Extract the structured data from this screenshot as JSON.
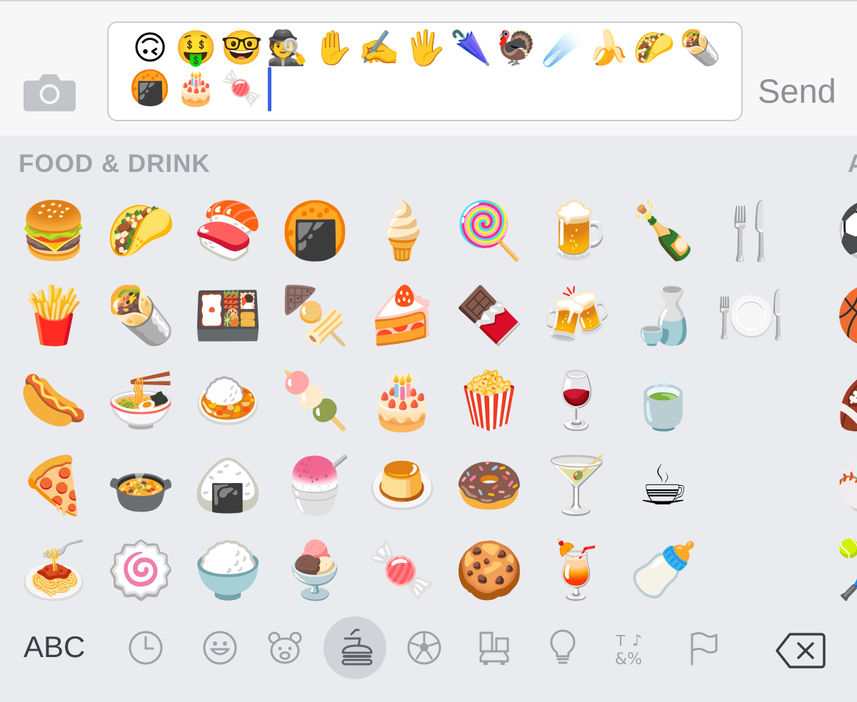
{
  "message": {
    "typed_emoji": [
      "🙃",
      "🤑",
      "🤓",
      "🕵️",
      "✋",
      "✍️",
      "🖐️",
      "🌂",
      "🦃",
      "☄️",
      "🍌",
      "🌮",
      "🌯",
      "🍘",
      "🎂",
      "🍬"
    ],
    "send_label": "Send"
  },
  "keyboard": {
    "category_title": "FOOD & DRINK",
    "next_category_initial": "A",
    "emoji_grid": [
      [
        "🍔",
        "🌮",
        "🍣",
        "🍘",
        "🍦",
        "🍭",
        "🍺",
        "🍾",
        "🍴"
      ],
      [
        "🍟",
        "🌯",
        "🍱",
        "🍢",
        "🍰",
        "🍫",
        "🍻",
        "🍶",
        "🍽️"
      ],
      [
        "🌭",
        "🍜",
        "🍛",
        "🍡",
        "🎂",
        "🍿",
        "🍷",
        "🍵",
        ""
      ],
      [
        "🍕",
        "🍲",
        "🍙",
        "🍧",
        "🍮",
        "🍩",
        "🍸",
        "☕",
        ""
      ],
      [
        "🍝",
        "🍥",
        "🍚",
        "🍨",
        "🍬",
        "🍪",
        "🍹",
        "🍼",
        ""
      ]
    ],
    "next_category_preview": [
      "⚽",
      "🏀",
      "🏈",
      "⚾",
      "🎾"
    ],
    "abc_label": "ABC",
    "tabs": [
      "recent",
      "smileys",
      "animals",
      "food",
      "activity",
      "travel",
      "objects",
      "symbols",
      "flags"
    ],
    "active_tab": "food"
  },
  "colors": {
    "caret": "#3b62e6",
    "send": "#8e9096",
    "icon": "#9ea1a7",
    "active_tab_bg": "#d0d3d8"
  }
}
